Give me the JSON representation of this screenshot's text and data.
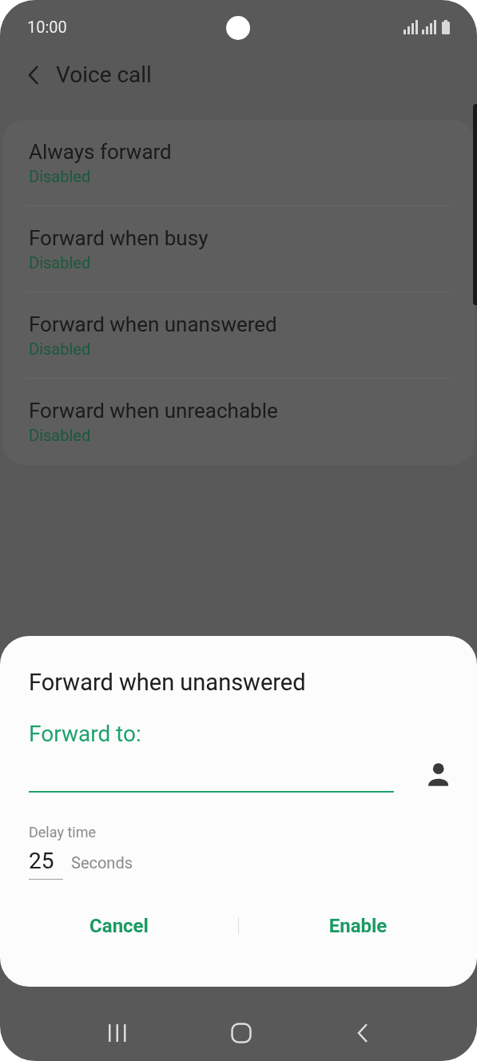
{
  "status_bar": {
    "time": "10:00"
  },
  "header": {
    "title": "Voice call"
  },
  "options": [
    {
      "title": "Always forward",
      "status": "Disabled"
    },
    {
      "title": "Forward when busy",
      "status": "Disabled"
    },
    {
      "title": "Forward when unanswered",
      "status": "Disabled"
    },
    {
      "title": "Forward when unreachable",
      "status": "Disabled"
    }
  ],
  "dialog": {
    "title": "Forward when unanswered",
    "field_label": "Forward to:",
    "focused": true,
    "delay_label": "Delay time",
    "delay_value": "25",
    "delay_unit": "Seconds",
    "buttons": [
      "Cancel",
      "Enable"
    ]
  }
}
